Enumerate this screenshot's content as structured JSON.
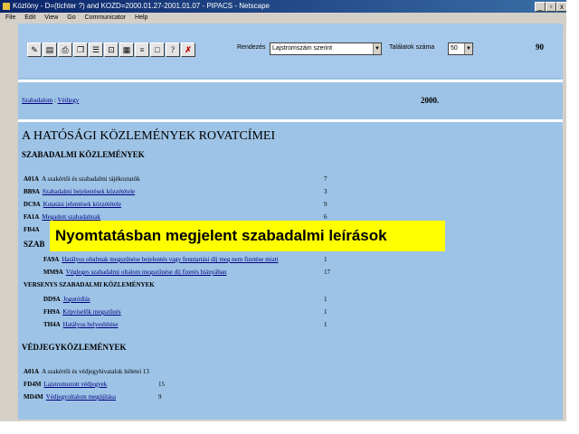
{
  "window": {
    "title": "Közlöny - D=(tichter ?) and KOZD=2000.01.27-2001.01.07 - PIPACS - Netscape"
  },
  "menu": [
    "File",
    "Edit",
    "View",
    "Go",
    "Communicator",
    "Help"
  ],
  "toolbar": {
    "sort_label": "Rendezés",
    "sort_value": "Lajstromszám szerint",
    "count_label": "Találatok száma",
    "count_value": "50",
    "counter": "90"
  },
  "nav": {
    "link1": "Szabadalom",
    "link2": "Védjegy",
    "year": "2000."
  },
  "page": {
    "heading": "A HATÓSÁGI KÖZLEMÉNYEK ROVATCÍMEI",
    "section1": "SZABADALMI KÖZLEMÉNYEK",
    "section1b": "SZAB",
    "section2": "VÉDJEGYKÖZLEMÉNYEK"
  },
  "rows": [
    {
      "code": "A01A",
      "text": "A szakértői és szabadalmi tájékoztatók",
      "num": "7"
    },
    {
      "code": "BB9A",
      "text": "Szabadalmi bejelentések közzététele",
      "num": "3"
    },
    {
      "code": "DC9A",
      "text": "Kutatási jelentések közzététele",
      "num": "9"
    },
    {
      "code": "FA1A",
      "text": "Megadott szabadalmak",
      "num": "6"
    },
    {
      "code": "FB4A",
      "text": "",
      "num": ""
    },
    {
      "code": "FA9A",
      "text": "Hatályos oltalmak megszűnése bejelentés vagy fenntartási díj meg nem fizetése miatt",
      "num": "1"
    },
    {
      "code": "MM9A",
      "text": "Végleges szabadalmi oltalom megszűnése díj fizetés hiányában",
      "num": "17"
    }
  ],
  "subsection": "VERSENYS SZABADALMI KÖZLEMÉNYEK",
  "subrows": [
    {
      "code": "DD9A",
      "text": "Jogutódlás",
      "num": "1"
    },
    {
      "code": "FH9A",
      "text": "Képviselők megszűnés",
      "num": "1"
    },
    {
      "code": "TH4A",
      "text": "Hatályos helyesbítése",
      "num": "1"
    }
  ],
  "vrows": [
    {
      "code": "A01A",
      "text": "A szakértői és védjegyhivatalok ítéletei",
      "num": "13"
    },
    {
      "code": "FD4M",
      "text": "Lajstromozott védjegyek",
      "num": "15"
    },
    {
      "code": "MD4M",
      "text": "Védjegyoltalom megújítása",
      "num": "9"
    }
  ],
  "banner": "Nyomtatásban megjelent szabadalmi leírások",
  "colors": {
    "bg": "#9dc3e6",
    "banner": "#ffff00",
    "titlebar": "#0a246a"
  }
}
